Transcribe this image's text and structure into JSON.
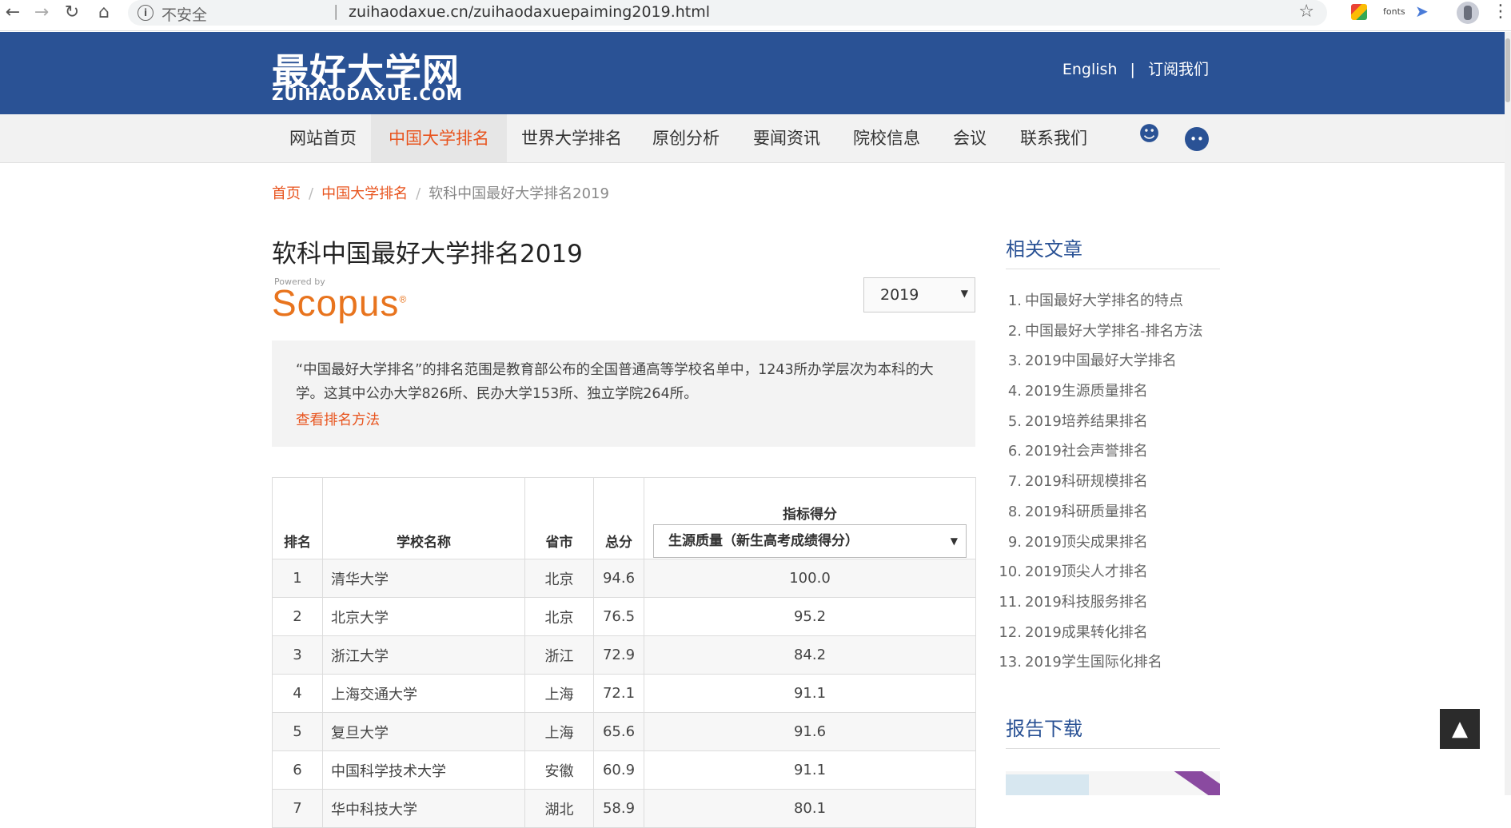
{
  "browser": {
    "insecure_label": "不安全",
    "url": "zuihaodaxue.cn/zuihaodaxuepaiming2019.html",
    "ext_fonts": "fonts"
  },
  "header": {
    "logo_cn": "最好大学网",
    "logo_en": "ZUIHAODAXUE.COM",
    "english": "English",
    "divider": "|",
    "subscribe": "订阅我们"
  },
  "nav": {
    "items": [
      "网站首页",
      "中国大学排名",
      "世界大学排名",
      "原创分析",
      "要闻资讯",
      "院校信息",
      "会议",
      "联系我们"
    ]
  },
  "breadcrumb": {
    "home": "首页",
    "cat": "中国大学排名",
    "current": "软科中国最好大学排名2019"
  },
  "main": {
    "title": "软科中国最好大学排名2019",
    "powered_by": "Powered by",
    "scopus": "Scopus",
    "year_selected": "2019",
    "intro": "“中国最好大学排名”的排名范围是教育部公布的全国普通高等学校名单中，1243所办学层次为本科的大学。这其中公办大学826所、民办大学153所、独立学院264所。",
    "method_link": "查看排名方法"
  },
  "table": {
    "headers": {
      "rank": "排名",
      "name": "学校名称",
      "province": "省市",
      "total": "总分",
      "indicator_title": "指标得分",
      "indicator_selected": "生源质量（新生高考成绩得分）"
    },
    "rows": [
      {
        "rank": "1",
        "name": "清华大学",
        "province": "北京",
        "total": "94.6",
        "score": "100.0"
      },
      {
        "rank": "2",
        "name": "北京大学",
        "province": "北京",
        "total": "76.5",
        "score": "95.2"
      },
      {
        "rank": "3",
        "name": "浙江大学",
        "province": "浙江",
        "total": "72.9",
        "score": "84.2"
      },
      {
        "rank": "4",
        "name": "上海交通大学",
        "province": "上海",
        "total": "72.1",
        "score": "91.1"
      },
      {
        "rank": "5",
        "name": "复旦大学",
        "province": "上海",
        "total": "65.6",
        "score": "91.6"
      },
      {
        "rank": "6",
        "name": "中国科学技术大学",
        "province": "安徽",
        "total": "60.9",
        "score": "91.1"
      },
      {
        "rank": "7",
        "name": "华中科技大学",
        "province": "湖北",
        "total": "58.9",
        "score": "80.1"
      }
    ]
  },
  "sidebar": {
    "title": "相关文章",
    "items": [
      {
        "num": "1.",
        "label": "中国最好大学排名的特点"
      },
      {
        "num": "2.",
        "label": "中国最好大学排名-排名方法"
      },
      {
        "num": "3.",
        "label": "2019中国最好大学排名"
      },
      {
        "num": "4.",
        "label": "2019生源质量排名"
      },
      {
        "num": "5.",
        "label": "2019培养结果排名"
      },
      {
        "num": "6.",
        "label": "2019社会声誉排名"
      },
      {
        "num": "7.",
        "label": "2019科研规模排名"
      },
      {
        "num": "8.",
        "label": "2019科研质量排名"
      },
      {
        "num": "9.",
        "label": "2019顶尖成果排名"
      },
      {
        "num": "10.",
        "label": "2019顶尖人才排名"
      },
      {
        "num": "11.",
        "label": "2019科技服务排名"
      },
      {
        "num": "12.",
        "label": "2019成果转化排名"
      },
      {
        "num": "13.",
        "label": "2019学生国际化排名"
      }
    ],
    "title2": "报告下载"
  },
  "colors": {
    "brand_blue": "#2a5295",
    "accent_orange": "#e8541e"
  }
}
